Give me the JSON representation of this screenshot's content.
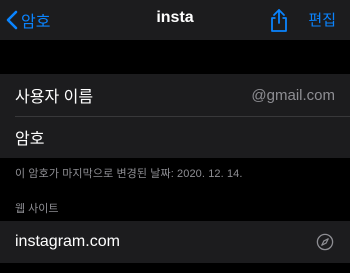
{
  "navbar": {
    "back_label": "암호",
    "title": "insta",
    "edit_label": "편집"
  },
  "credentials": {
    "username_label": "사용자 이름",
    "username_value": "@gmail.com",
    "password_label": "암호"
  },
  "password_changed_note": "이 암호가 마지막으로 변경된 날짜: 2020. 12. 14.",
  "website": {
    "header": "웹 사이트",
    "url": "instagram.com"
  },
  "colors": {
    "accent": "#0a84ff",
    "background": "#000000",
    "cell_background": "#1c1c1e",
    "secondary_text": "#8e8e93"
  },
  "icons": {
    "back": "chevron-left-icon",
    "share": "share-icon",
    "open_site": "compass-icon"
  }
}
